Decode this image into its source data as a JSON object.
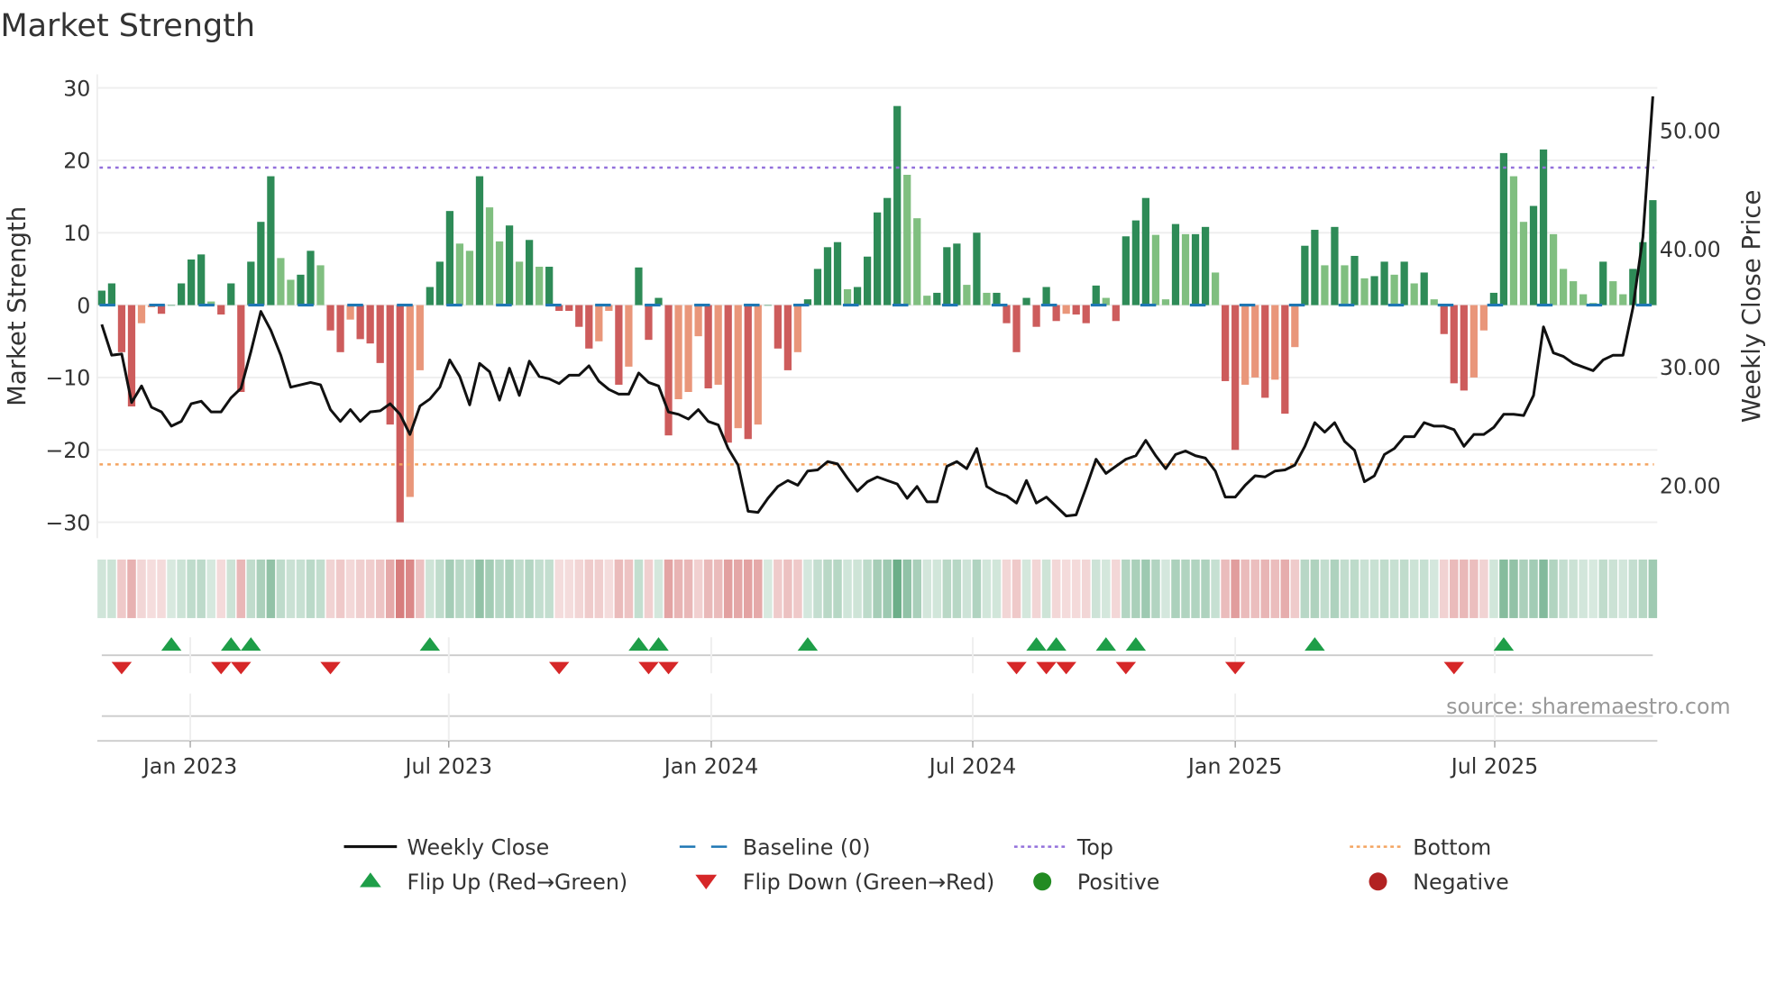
{
  "chart_data": {
    "type": "bar",
    "title": "Market Strength",
    "ylabel": "Market Strength",
    "y2label": "Weekly Close Price",
    "ylim": [
      -32,
      32
    ],
    "y2lim": [
      15,
      56
    ],
    "yticks": [
      30,
      20,
      10,
      0,
      -10,
      -20,
      -30
    ],
    "yticklabels": [
      "30",
      "20",
      "10",
      "0",
      "−10",
      "−20",
      "−30"
    ],
    "y2ticks": [
      50,
      40,
      30,
      20
    ],
    "y2ticklabels": [
      "50.00",
      "40.00",
      "30.00",
      "20.00"
    ],
    "xticks": [
      {
        "week": 8.9,
        "label": "Jan 2023"
      },
      {
        "week": 34.9,
        "label": "Jul 2023"
      },
      {
        "week": 61.3,
        "label": "Jan 2024"
      },
      {
        "week": 87.6,
        "label": "Jul 2024"
      },
      {
        "week": 114,
        "label": "Jan 2025"
      },
      {
        "week": 140.1,
        "label": "Jul 2025"
      }
    ],
    "top_level": 19,
    "bottom_level": -22,
    "strength": [
      2,
      3,
      -6.5,
      -14,
      -2.5,
      -0.3,
      -1.2,
      0,
      3,
      6.3,
      7,
      0.5,
      -1.3,
      3,
      -12,
      6,
      11.5,
      17.8,
      6.5,
      3.5,
      4.2,
      7.5,
      5.5,
      -3.5,
      -6.5,
      -2,
      -4.7,
      -5.3,
      -8,
      -16.5,
      -30,
      -26.5,
      -9,
      2.5,
      6,
      13,
      8.5,
      7.5,
      17.8,
      13.5,
      8.8,
      11,
      6,
      9,
      5.3,
      5.3,
      -0.8,
      -0.8,
      -3,
      -6,
      -5,
      -0.8,
      -11,
      -8.5,
      5.2,
      -4.8,
      1,
      -18,
      -13,
      -12,
      -4.3,
      -11.5,
      -11,
      -19,
      -17,
      -18.5,
      -16.5,
      0,
      -6,
      -9,
      -6.5,
      0.8,
      5,
      8,
      8.7,
      2.2,
      2.5,
      6.7,
      12.8,
      14.8,
      27.5,
      18,
      12,
      1.3,
      1.7,
      8,
      8.5,
      2.8,
      10,
      1.7,
      1.7,
      -2.5,
      -6.5,
      1,
      -3,
      2.5,
      -2.2,
      -1.2,
      -1.3,
      -2.5,
      2.7,
      1,
      -2.2,
      9.5,
      11.7,
      14.8,
      9.7,
      0.8,
      11.2,
      9.8,
      9.8,
      10.8,
      4.5,
      -10.5,
      -20,
      -11,
      -10,
      -12.8,
      -10.3,
      -15,
      -5.8,
      8.2,
      10.4,
      5.5,
      10.8,
      5.5,
      6.8,
      3.7,
      4,
      6,
      4.2,
      6,
      3,
      4.5,
      0.8,
      -4,
      -10.8,
      -11.8,
      -10,
      -3.5,
      1.7,
      21,
      17.8,
      11.5,
      13.7,
      21.5,
      9.8,
      5,
      3.3,
      1.5,
      0.3,
      6,
      3.3,
      1.5,
      5,
      8.7,
      14.5
    ],
    "weekly_close": [
      33.6,
      31,
      31.1,
      27,
      28.4,
      26.6,
      26.2,
      25,
      25.4,
      26.9,
      27.1,
      26.2,
      26.2,
      27.4,
      28.2,
      31.3,
      34.7,
      33.1,
      31,
      28.3,
      28.5,
      28.7,
      28.5,
      26.4,
      25.4,
      26.4,
      25.4,
      26.2,
      26.3,
      26.9,
      26,
      24.3,
      26.7,
      27.3,
      28.3,
      30.6,
      29.2,
      26.8,
      30.3,
      29.6,
      27.2,
      29.9,
      27.6,
      30.5,
      29.2,
      29,
      28.6,
      29.3,
      29.3,
      30.1,
      28.8,
      28.1,
      27.7,
      27.7,
      29.5,
      28.7,
      28.4,
      26.2,
      26,
      25.6,
      26.4,
      25.4,
      25.1,
      23.1,
      21.7,
      17.8,
      17.7,
      18.9,
      19.9,
      20.4,
      20,
      21.2,
      21.3,
      22,
      21.8,
      20.6,
      19.5,
      20.3,
      20.7,
      20.4,
      20.1,
      18.9,
      19.9,
      18.6,
      18.6,
      21.6,
      22,
      21.4,
      23.1,
      19.9,
      19.4,
      19.1,
      18.5,
      20.4,
      18.5,
      19,
      18.2,
      17.4,
      17.5,
      19.8,
      22.2,
      21,
      21.6,
      22.2,
      22.5,
      23.8,
      22.5,
      21.4,
      22.6,
      22.9,
      22.5,
      22.3,
      21.2,
      19,
      19,
      20,
      20.8,
      20.7,
      21.2,
      21.3,
      21.7,
      23.3,
      25.3,
      24.5,
      25.3,
      23.7,
      22.95,
      20.3,
      20.8,
      22.6,
      23.1,
      24.1,
      24.1,
      25.3,
      25,
      25,
      24.7,
      23.3,
      24.3,
      24.3,
      24.9,
      26,
      26,
      25.9,
      27.6,
      33.4,
      31.2,
      30.9,
      30.3,
      30,
      29.7,
      30.6,
      31,
      31,
      35,
      41,
      52.9
    ],
    "flip_up_weeks": [
      7,
      13,
      15,
      33,
      54,
      56,
      71,
      94,
      96,
      101,
      104,
      122,
      141
    ],
    "flip_down_weeks": [
      2,
      12,
      14,
      23,
      46,
      55,
      57,
      92,
      95,
      97,
      103,
      114,
      136
    ],
    "legend": [
      {
        "label": "Weekly Close",
        "icon": "line"
      },
      {
        "label": "Baseline (0)",
        "icon": "dashed-line"
      },
      {
        "label": "Top",
        "icon": "dotted-line"
      },
      {
        "label": "Bottom",
        "icon": "dotted-line"
      },
      {
        "label": "Flip Up (Red→Green)",
        "icon": "triangle-up"
      },
      {
        "label": "Flip Down (Green→Red)",
        "icon": "triangle-down"
      },
      {
        "label": "Positive",
        "icon": "circle"
      },
      {
        "label": "Negative",
        "icon": "circle"
      }
    ],
    "legend_placement": "bottom",
    "source": "source: sharemaestro.com",
    "colors": {
      "pos_strong": "#2e8b57",
      "pos_weak": "#80bf80",
      "neg_strong": "#cd5c5c",
      "neg_weak": "#e9967a",
      "baseline": "#1f77b4",
      "top": "#9370db",
      "bottom": "#f4a460",
      "close": "#111111",
      "flip_up": "#1e9e48",
      "flip_down": "#d62728",
      "positive": "#228b22",
      "negative": "#b22222"
    }
  }
}
